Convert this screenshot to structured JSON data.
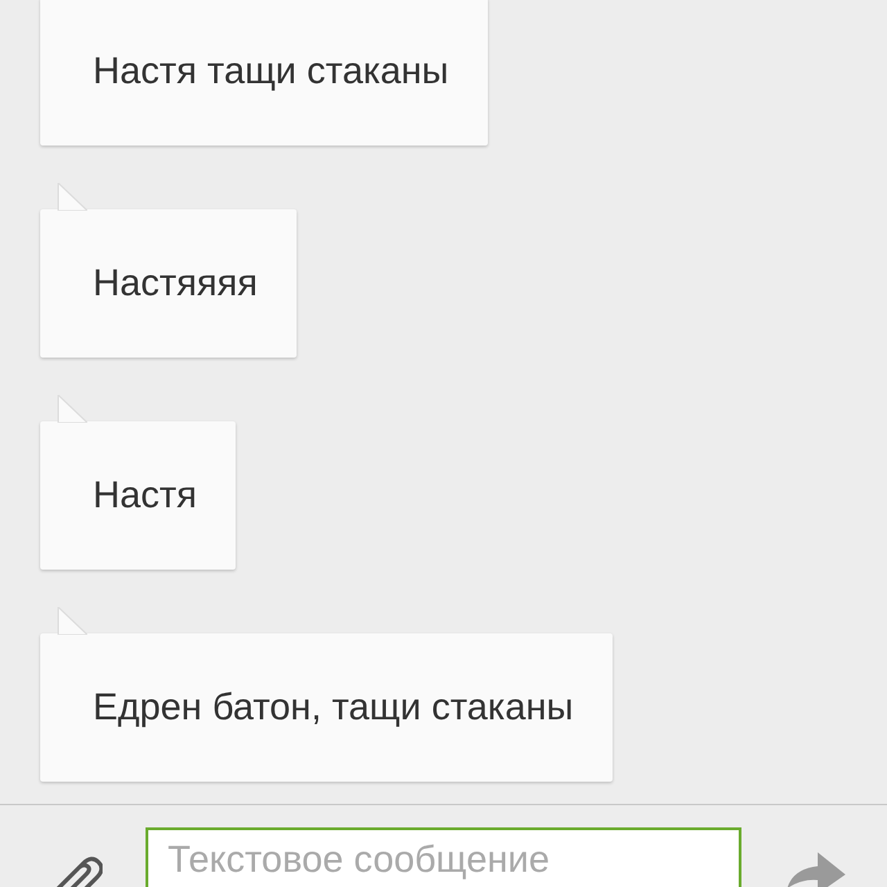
{
  "messages": [
    {
      "text": "Настя тащи стаканы"
    },
    {
      "text": "Настяяяя"
    },
    {
      "text": "Настя"
    },
    {
      "text": "Едрен батон, тащи стаканы"
    }
  ],
  "composer": {
    "placeholder": "Текстовое сообщение"
  }
}
